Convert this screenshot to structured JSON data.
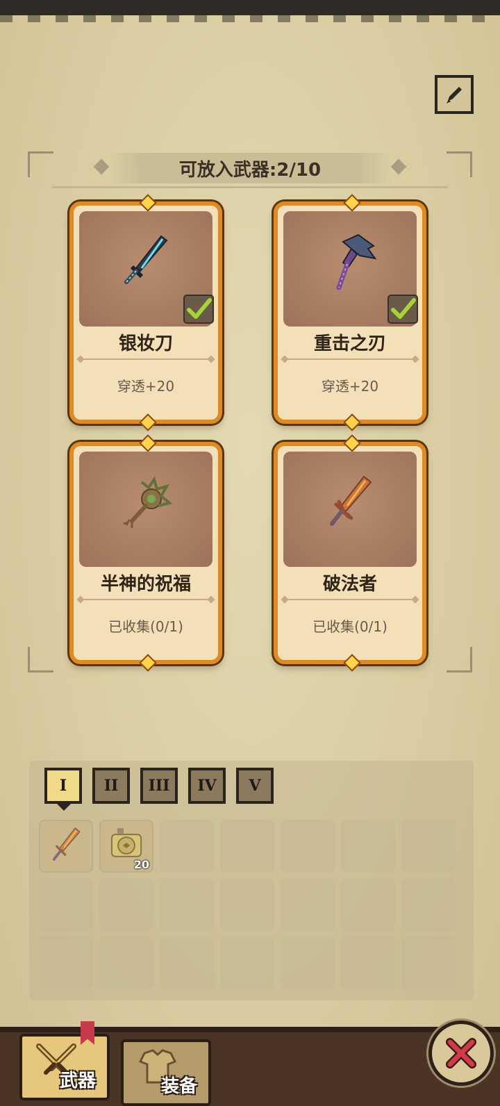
{
  "header": {
    "edit_icon": "pen-icon"
  },
  "collection": {
    "title": "可放入武器:2/10",
    "cards": [
      {
        "name": "银妆刀",
        "info": "穿透+20",
        "selected": true,
        "icon": "sword-blue-icon"
      },
      {
        "name": "重击之刃",
        "info": "穿透+20",
        "selected": true,
        "icon": "axe-purple-icon"
      },
      {
        "name": "半神的祝福",
        "info": "已收集(0/1)",
        "selected": false,
        "icon": "mace-green-icon"
      },
      {
        "name": "破法者",
        "info": "已收集(0/1)",
        "selected": false,
        "icon": "sword-flame-icon"
      }
    ]
  },
  "inventory": {
    "tiers": [
      "I",
      "II",
      "III",
      "IV",
      "V"
    ],
    "active_tier": "I",
    "items": [
      {
        "icon": "sword-flame-icon",
        "qty": ""
      },
      {
        "icon": "locked-scroll-icon",
        "qty": "20"
      }
    ]
  },
  "nav": {
    "weapon_label": "武器",
    "equip_label": "装备",
    "close_icon": "close-icon"
  },
  "colors": {
    "card_border": "#e08a23",
    "check": "#a6d23a",
    "close_x": "#d23b4a"
  }
}
